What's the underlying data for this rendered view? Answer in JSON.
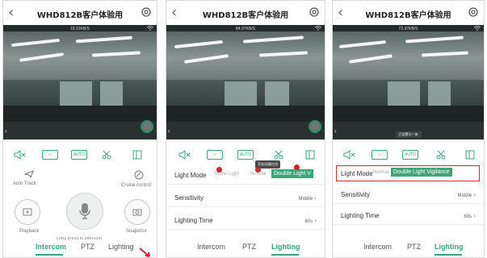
{
  "app": {
    "title": "WHD812B客户体验用"
  },
  "panels": [
    {
      "speed": "18.22KB/S",
      "toolbar": {
        "auto_label": "AUTO"
      },
      "actions": {
        "auto_track": "Auto Track",
        "cruise_control": "Cruise control",
        "playback": "Playback",
        "snapshot": "Snapshot",
        "hint": "Long press to intercom"
      },
      "tabs": [
        "Intercom",
        "PTZ",
        "Lighting"
      ],
      "active_tab": "Intercom"
    },
    {
      "speed": "84.07KB/S",
      "toolbar": {
        "auto_label": "AUTO"
      },
      "light_mode": {
        "label": "Light Mode",
        "options": [
          "White Light",
          "Normal",
          "Double Light V"
        ],
        "selected": "Double Light V",
        "popover": "开启/切换白光"
      },
      "rows": [
        {
          "label": "Sensitivity",
          "value": "Middle"
        },
        {
          "label": "Lighting Time",
          "value": "60s"
        }
      ],
      "tabs": [
        "Intercom",
        "PTZ",
        "Lighting"
      ],
      "active_tab": "Lighting"
    },
    {
      "speed": "72.37KB/S",
      "toolbar": {
        "auto_label": "AUTO"
      },
      "tooltip": "已设置为一体",
      "light_mode": {
        "label": "Light Mode",
        "options": [
          "Normal",
          "Double Light Vigilance"
        ],
        "selected": "Double Light Vigilance"
      },
      "rows": [
        {
          "label": "Sensitivity",
          "value": "Middle"
        },
        {
          "label": "Lighting Time",
          "value": "60s"
        }
      ],
      "tabs": [
        "Intercom",
        "PTZ",
        "Lighting"
      ],
      "active_tab": "Lighting"
    }
  ],
  "colors": {
    "accent": "#3aa57b",
    "alert": "#d0232a"
  }
}
